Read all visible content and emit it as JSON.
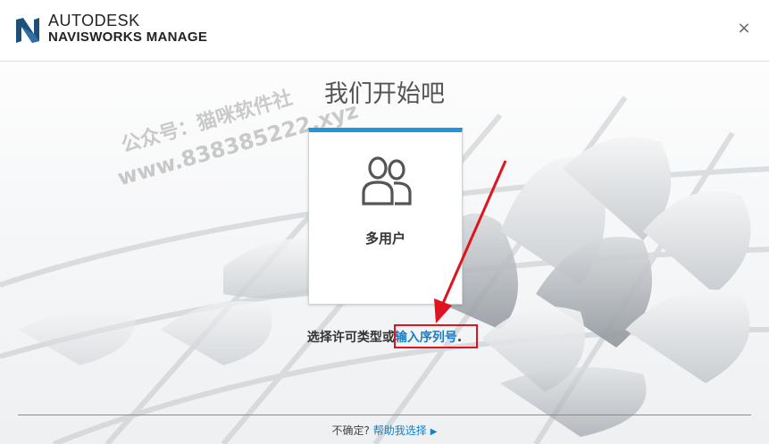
{
  "header": {
    "brand_top": "AUTODESK",
    "brand_bottom": "NAVISWORKS MANAGE",
    "close_label": "×"
  },
  "main": {
    "title": "我们开始吧",
    "card": {
      "label": "多用户",
      "icon": "users-icon"
    },
    "prompt_text": "选择许可类型或",
    "serial_link": "输入序列号",
    "prompt_end": "."
  },
  "footer": {
    "unsure_text": "不确定?",
    "help_link": "帮助我选择",
    "arrow": "▶"
  },
  "watermark": {
    "line1": "公众号：猫咪软件社",
    "line2": "www.838385222.xyz"
  },
  "colors": {
    "accent": "#2196d8",
    "link": "#1a7ec4",
    "annotation": "#e0141e"
  }
}
